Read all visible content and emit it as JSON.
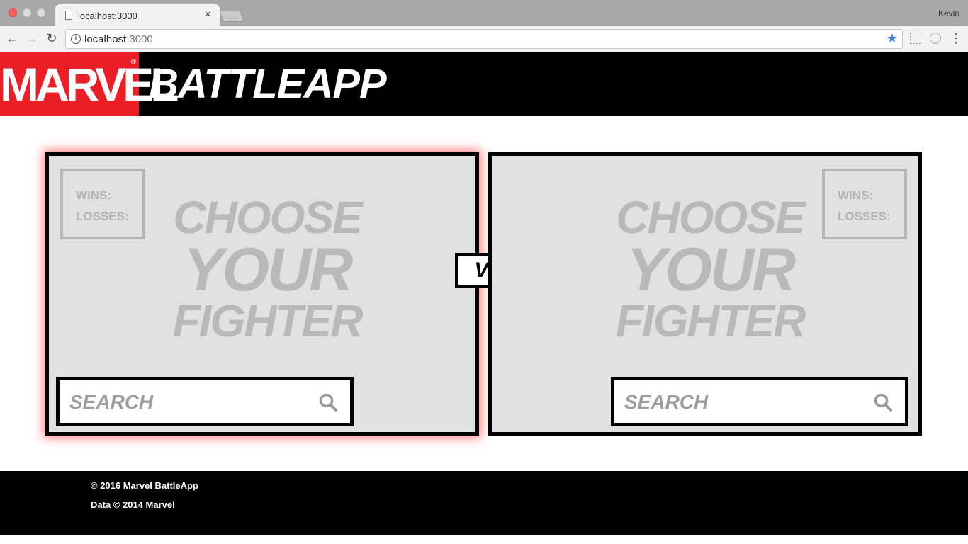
{
  "browser": {
    "tab_title": "localhost:3000",
    "tab_close": "×",
    "profile_name": "Kevin",
    "url_host": "localhost",
    "url_port": ":3000"
  },
  "header": {
    "logo_text": "MARVEL",
    "logo_reg": "®",
    "title": "BATTLEAPP"
  },
  "fighters": [
    {
      "wins_label": "WINS:",
      "losses_label": "LOSSES:",
      "choose_line1": "CHOOSE",
      "choose_line2": "YOUR",
      "choose_line3": "FIGHTER",
      "search_placeholder": "SEARCH"
    },
    {
      "wins_label": "WINS:",
      "losses_label": "LOSSES:",
      "choose_line1": "CHOOSE",
      "choose_line2": "YOUR",
      "choose_line3": "FIGHTER",
      "search_placeholder": "SEARCH"
    }
  ],
  "vs_label": "VS.",
  "footer": {
    "copyright": "© 2016 Marvel BattleApp",
    "data_credit": "Data © 2014 Marvel"
  },
  "colors": {
    "marvel_red": "#ec1d24",
    "active_glow": "#ff4646",
    "panel_bg": "#e1e1e1"
  }
}
